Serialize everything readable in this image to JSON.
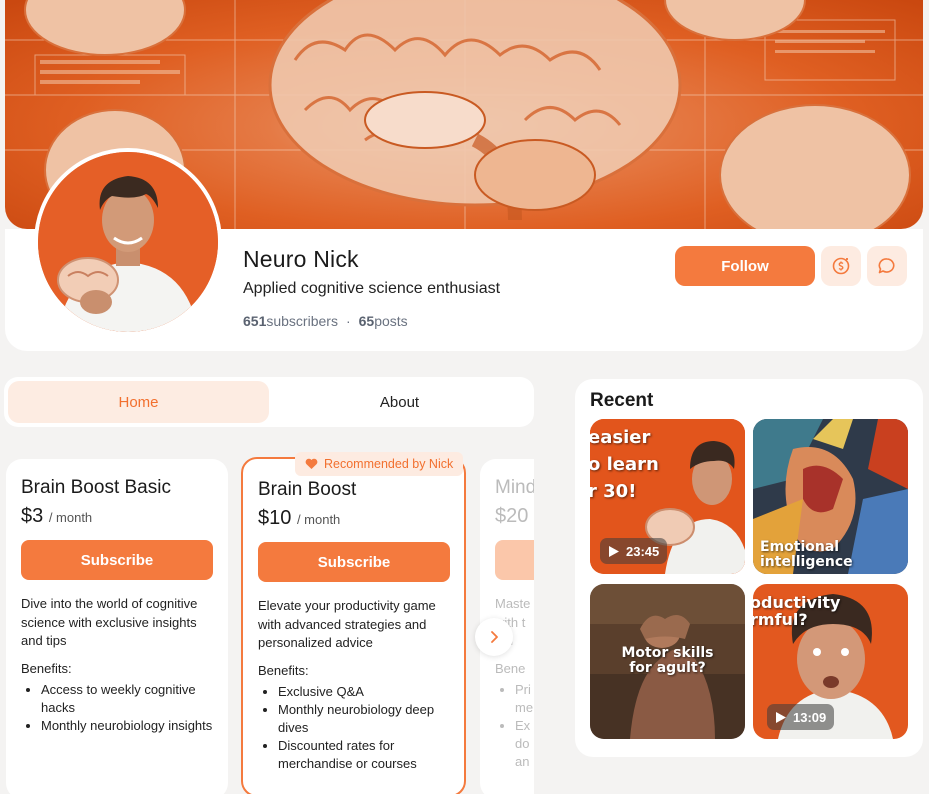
{
  "profile": {
    "name": "Neuro Nick",
    "tagline": "Applied cognitive science enthusiast",
    "subscribers_count": "651",
    "subscribers_label": "subscribers",
    "separator": "·",
    "posts_count": "65",
    "posts_label": "posts",
    "follow_label": "Follow"
  },
  "tabs": [
    {
      "label": "Home",
      "active": true
    },
    {
      "label": "About",
      "active": false
    }
  ],
  "plans": [
    {
      "title": "Brain Boost Basic",
      "price": "$3",
      "period": "/ month",
      "button": "Subscribe",
      "description": "Dive into the world of cognitive science with exclusive insights and tips",
      "benefits_label": "Benefits:",
      "benefits": [
        "Access to weekly cognitive hacks",
        "Monthly neurobiology insights"
      ]
    },
    {
      "title": "Brain Boost",
      "price": "$10",
      "period": "/ month",
      "button": "Subscribe",
      "badge": "Recommended by Nick",
      "description": "Elevate your productivity game with advanced strategies and personalized advice",
      "benefits_label": "Benefits:",
      "benefits": [
        "Exclusive Q&A",
        "Monthly neurobiology deep dives",
        "Discounted rates for merchandise or courses"
      ]
    },
    {
      "title": "Mind",
      "price": "$20",
      "description_lines": [
        "Maste",
        "with t",
        "oth"
      ],
      "benefits_label": "Bene",
      "benefits_fragments": [
        "Pri",
        "me",
        "Ex",
        "do",
        "an"
      ]
    }
  ],
  "recent": {
    "title": "Recent",
    "items": [
      {
        "text_lines": [
          "easier",
          "o learn",
          "r 30!"
        ],
        "duration": "23:45"
      },
      {
        "text_lines": [
          "Emotional",
          "intelligence"
        ]
      },
      {
        "text_lines": [
          "Motor skills",
          "for agult?"
        ]
      },
      {
        "text_lines": [
          "oductivity",
          "rmful?"
        ],
        "duration": "13:09"
      }
    ]
  },
  "colors": {
    "accent": "#f47a3e",
    "accent_light": "#fdebe1",
    "page_bg": "#f4f3f2"
  }
}
